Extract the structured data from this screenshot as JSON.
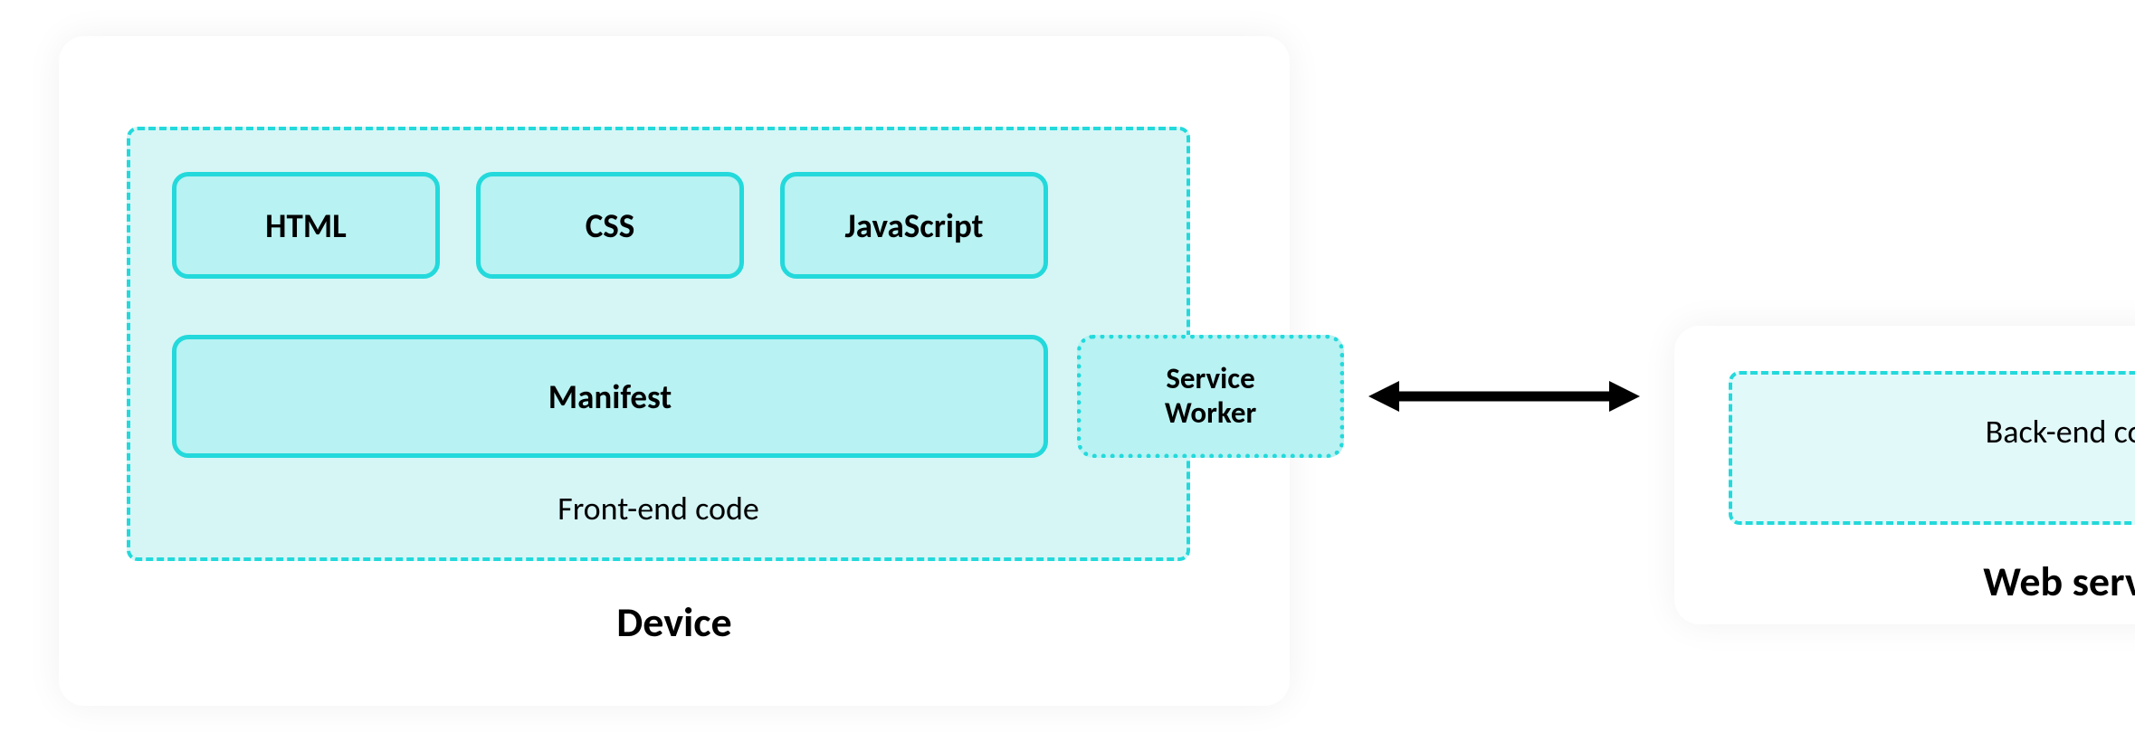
{
  "device": {
    "title": "Device",
    "frontend": {
      "caption": "Front-end code",
      "tech": {
        "html": "HTML",
        "css": "CSS",
        "javascript": "JavaScript",
        "manifest": "Manifest"
      },
      "service_worker": "Service\nWorker"
    }
  },
  "server": {
    "title": "Web server",
    "backend_caption": "Back-end code"
  },
  "arrow": {
    "label": "bidirectional-communication"
  },
  "colors": {
    "accent": "#23d9db",
    "fill_light": "#d6f6f6",
    "fill_box": "#b8f2f2"
  }
}
